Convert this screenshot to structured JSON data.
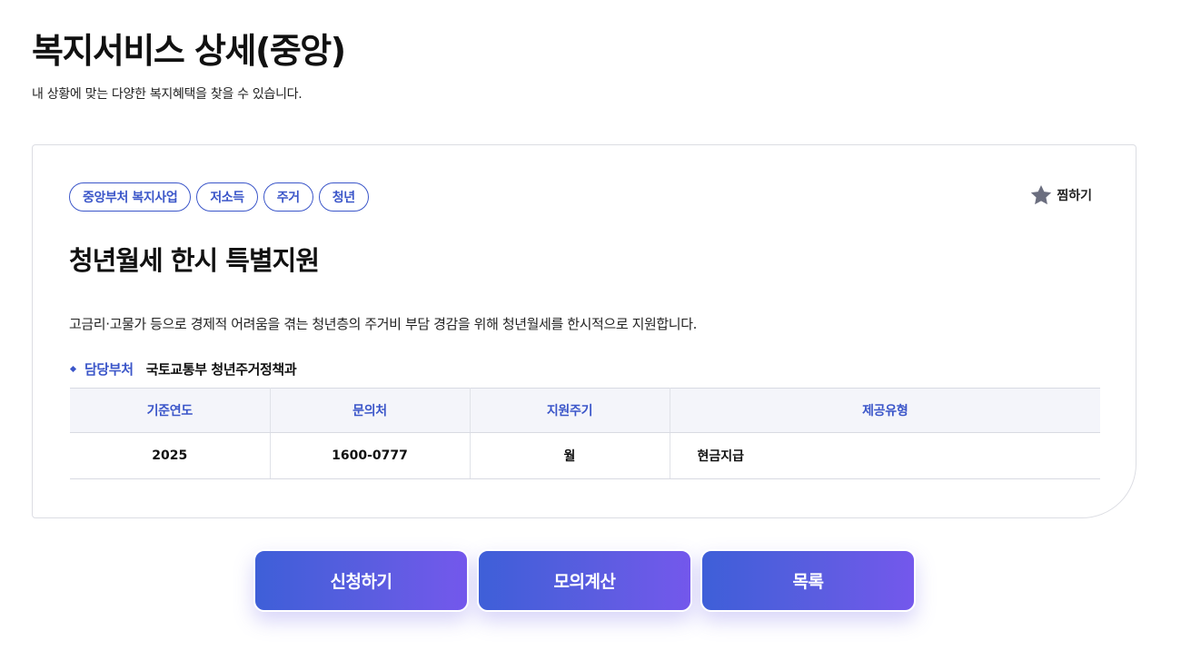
{
  "header": {
    "title": "복지서비스 상세(중앙)",
    "subtitle": "내 상황에 맞는 다양한 복지혜택을 찾을 수 있습니다."
  },
  "service": {
    "tags": [
      "중앙부처 복지사업",
      "저소득",
      "주거",
      "청년"
    ],
    "bookmark_label": "찜하기",
    "title": "청년월세 한시 특별지원",
    "description": "고금리·고물가 등으로 경제적 어려움을 겪는 청년층의 주거비 부담 경감을 위해 청년월세를 한시적으로 지원합니다.",
    "department_label": "담당부처",
    "department_value": "국토교통부 청년주거정책과"
  },
  "table": {
    "headers": [
      "기준연도",
      "문의처",
      "지원주기",
      "제공유형"
    ],
    "row": [
      "2025",
      "1600-0777",
      "월",
      "현금지급"
    ]
  },
  "actions": {
    "apply": "신청하기",
    "simulate": "모의계산",
    "list": "목록"
  },
  "colors": {
    "accent": "#3b56c9",
    "button_start": "#3e5fd8",
    "button_end": "#7458ec",
    "star": "#6b6e7f"
  },
  "icons": {
    "bookmark": "star-icon"
  }
}
